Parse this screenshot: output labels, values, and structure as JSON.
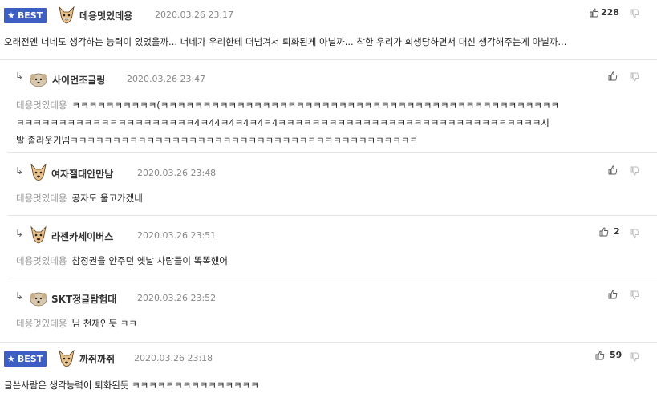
{
  "comments": [
    {
      "badge": "BEST",
      "nickname": "데용멋있데용",
      "date": "2020.03.26 23:17",
      "up_count": "228",
      "text": "오래전엔 너네도 생각하는 능력이 있었을까... 너네가 우리한테 떠넘겨서 퇴화된게 아닐까... 착한 우리가 희생당하면서 대신 생각해주는게 아닐까..."
    },
    {
      "nickname": "사이먼조글링",
      "date": "2020.03.26 23:47",
      "mention": "데용멋있데용",
      "text_line1": "ㅋㅋㅋㅋㅋㅋㅋㅋㅋㅋ(ㅋㅋㅋㅋㅋㅋㅋㅋㅋㅋㅋㅋㅋㅋㅋㅋㅋㅋㅋㅋㅋㅋㅋㅋㅋㅋㅋㅋㅋㅋㅋㅋㅋㅋㅋㅋㅋㅋㅋㅋㅋㅋㅋㅋㅋㅋㅋ",
      "text_line2": "ㅋㅋㅋㅋㅋㅋㅋㅋㅋㅋㅋㅋㅋㅋㅋㅋㅋㅋㅋㅋㅋ4ㅋ44ㅋ4ㅋ4ㅋ4ㅋ4ㅋㅋㅋㅋㅋㅋㅋㅋㅋㅋㅋㅋㅋㅋㅋㅋㅋㅋㅋㅋㅋㅋㅋㅋㅋㅋㅋㅋㅋㅋㅋ시",
      "text_line3": "발 졸라웃기넴ㅋㅋㅋㅋㅋㅋㅋㅋㅋㅋㅋㅋㅋㅋㅋㅋㅋㅋㅋㅋㅋㅋㅋㅋㅋㅋㅋㅋㅋㅋㅋㅋㅋㅋㅋㅋㅋㅋㅋㅋㅋ",
      "up_count": ""
    },
    {
      "nickname": "여자절대안만남",
      "date": "2020.03.26 23:48",
      "mention": "데용멋있데용",
      "text": "공자도 울고가겠네",
      "up_count": ""
    },
    {
      "nickname": "라젠카세이버스",
      "date": "2020.03.26 23:51",
      "mention": "데용멋있데용",
      "text": "참정권을 안주던 옛날 사람들이 똑똑했어",
      "up_count": "2"
    },
    {
      "nickname": "SKT정글탐험대",
      "date": "2020.03.26 23:52",
      "mention": "데용멋있데용",
      "text": "님 천재인듯 ㅋㅋ",
      "up_count": ""
    },
    {
      "badge": "BEST",
      "nickname": "까쥐까쥐",
      "date": "2020.03.26 23:18",
      "up_count": "59",
      "text": "글쓴사람은 생각능력이 퇴화된듯 ㅋㅋㅋㅋㅋㅋㅋㅋㅋㅋㅋㅋㅋㅋㅋ"
    }
  ],
  "icons": {
    "reply_arrow": "↳",
    "badge_star": "★",
    "avatar_dog": "dog-icon",
    "avatar_puppy": "puppy-icon",
    "thumb_up": "thumb-up-icon",
    "thumb_down": "thumb-down-icon"
  },
  "colors": {
    "badge_bg": "#3d5fc4",
    "mention": "#999999",
    "divider": "#e4e4e4"
  }
}
